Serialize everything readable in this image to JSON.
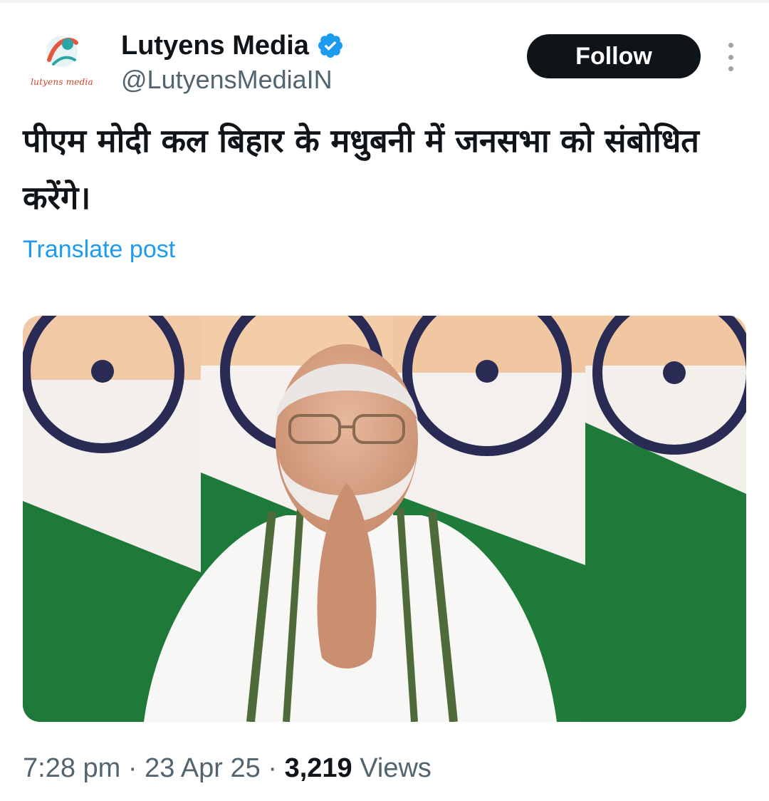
{
  "account": {
    "display_name": "Lutyens Media",
    "handle": "@LutyensMediaIN",
    "avatar_caption": "lutyens media",
    "verified_icon": "verified-badge-icon",
    "accent_color": "#1d9bf0"
  },
  "follow_label": "Follow",
  "more_icon": "more-vertical-icon",
  "post": {
    "text": "पीएम मोदी कल बिहार के मधुबनी में जनसभा को संबोधित करेंगे।",
    "translate_label": "Translate post"
  },
  "footer": {
    "time": "7:28 pm",
    "sep1": " · ",
    "date": "23 Apr 25",
    "sep2": " · ",
    "views": "3,219",
    "views_label": " Views"
  }
}
